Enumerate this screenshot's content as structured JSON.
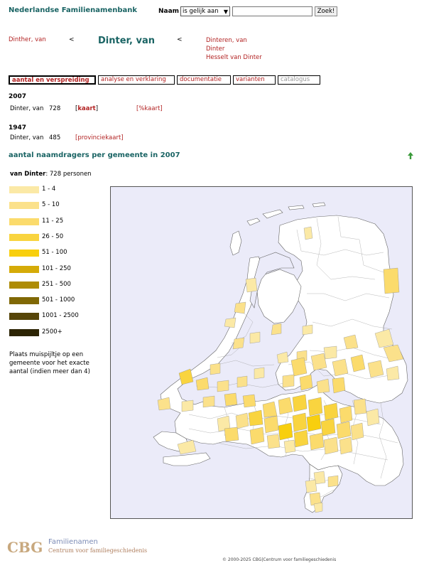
{
  "header": {
    "site_title": "Nederlandse Familienamenbank",
    "naam_label": "Naam",
    "select_value": "is gelijk aan",
    "search_value": "",
    "search_button": "Zoek!"
  },
  "nav": {
    "previous": "Dinther, van",
    "prev_sep": "<",
    "current": "Dinter, van",
    "next_sep": "<",
    "next_items": [
      "Dinteren, van",
      "Dinter",
      "Hesselt van Dinter"
    ]
  },
  "tabs": [
    {
      "label": "aantal en verspreiding",
      "state": "active"
    },
    {
      "label": "analyse en verklaring",
      "state": "normal"
    },
    {
      "label": "documentatie",
      "state": "normal"
    },
    {
      "label": "varianten",
      "state": "normal"
    },
    {
      "label": "catalogus",
      "state": "disabled"
    }
  ],
  "counts": [
    {
      "year": "2007",
      "name": "Dinter, van",
      "count": "728",
      "link1": "kaart",
      "link2": "[%kaart]"
    },
    {
      "year": "1947",
      "name": "Dinter, van",
      "count": "485",
      "link1": "[provinciekaart]"
    }
  ],
  "section_title": "aantal naamdragers per gemeente in 2007",
  "legend": {
    "name": "van Dinter",
    "total": ": 728 personen",
    "classes": [
      {
        "label": "1 - 4",
        "color": "#fbe9a6"
      },
      {
        "label": "5 - 10",
        "color": "#fbe18b"
      },
      {
        "label": "11 - 25",
        "color": "#fbdb6c"
      },
      {
        "label": "26 - 50",
        "color": "#f9d43f"
      },
      {
        "label": "51 - 100",
        "color": "#f8cf0e"
      },
      {
        "label": "101 - 250",
        "color": "#d5ab08"
      },
      {
        "label": "251 - 500",
        "color": "#ae8c05"
      },
      {
        "label": "501 - 1000",
        "color": "#806805"
      },
      {
        "label": "1001 - 2500",
        "color": "#564508"
      },
      {
        "label": "2500+",
        "color": "#2c2404"
      }
    ],
    "hint": "Plaats muispijltje op een gemeente voor het exacte aantal (indien meer dan 4)"
  },
  "map": {
    "water_color": "#ebebf9",
    "land_color": "#ffffff",
    "border_color": "#555555"
  },
  "footer": {
    "logo": "CBG",
    "brand": "Familienamen",
    "subtitle": "Centrum voor familiegeschiedenis",
    "copyright": "© 2000-2025 CBG|Centrum voor familiegeschiedenis"
  }
}
